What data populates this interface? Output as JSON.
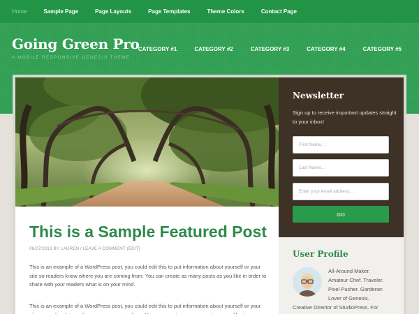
{
  "top_nav": {
    "items": [
      "Home",
      "Sample Page",
      "Page Layouts",
      "Page Templates",
      "Theme Colors",
      "Contact Page"
    ]
  },
  "header": {
    "title": "Going Green Pro",
    "description": "A MOBILE RESPONSIVE GENESIS THEME",
    "categories": [
      "CATEGORY #1",
      "CATEGORY #2",
      "CATEGORY #3",
      "CATEGORY #4",
      "CATEGORY #5"
    ]
  },
  "post": {
    "title": "This is a Sample Featured Post",
    "date": "06/27/2013",
    "by": "BY",
    "author": "LAUREN",
    "sep": "/",
    "comment_link": "LEAVE A COMMENT",
    "edit_link": "(EDIT)",
    "para1": "This is an example of a WordPress post, you could edit this to put information about yourself or your site so readers know where you are coming from. You can create as many posts as you like in order to share with your readers what is on your mind.",
    "para2": "This is an example of a WordPress post, you could edit this to put information about yourself or your site so readers know where you are coming from. You can create as many posts as you like in"
  },
  "newsletter": {
    "title": "Newsletter",
    "text": "Sign up to receive important updates straight to your inbox!",
    "first_name_placeholder": "First Name...",
    "last_name_placeholder": "Last Name...",
    "email_placeholder": "Enter your email address...",
    "button": "GO"
  },
  "user_profile": {
    "title": "User Profile",
    "lines": [
      "All-Around Maker.",
      "Amateur Chef. Traveler.",
      "Pixel Pusher. Gardener.",
      "Lover of Genesis.",
      "Creative Director of StudioPress. For"
    ]
  },
  "colors": {
    "nav_bg": "#229446",
    "header_bg": "#2f9e52",
    "accent_green": "#2d8a4a",
    "newsletter_bg": "#3e3125",
    "button_green": "#2a9a4b",
    "page_bg": "#e4e1db"
  }
}
